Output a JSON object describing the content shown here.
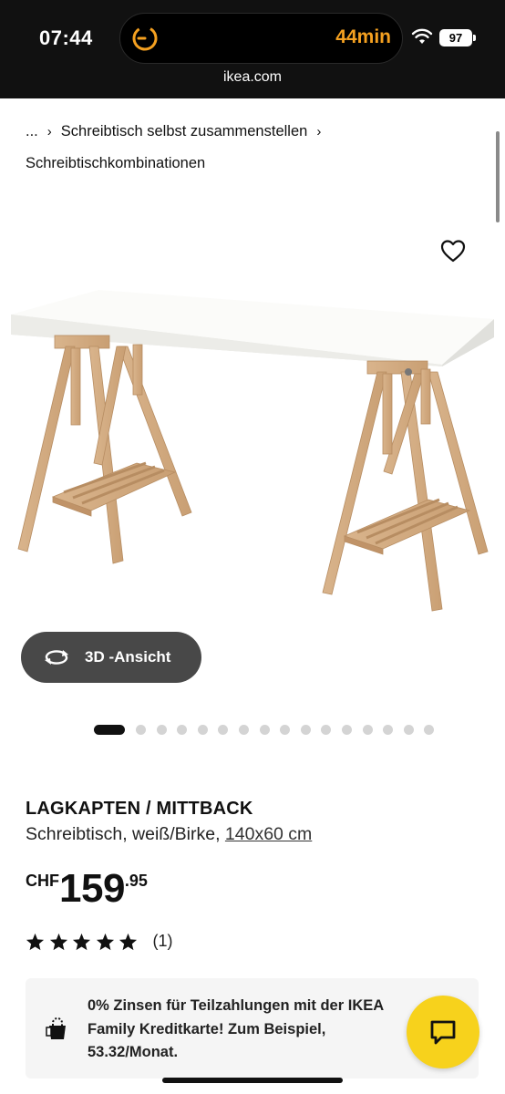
{
  "status_bar": {
    "time": "07:44",
    "timer_label": "44min",
    "battery": "97",
    "url": "ikea.com",
    "accent_color": "#f4a020"
  },
  "breadcrumb": {
    "ellipsis": "...",
    "items": [
      "Schreibtisch selbst zusammenstellen",
      "Schreibtischkombinationen"
    ]
  },
  "product": {
    "name": "LAGKAPTEN / MITTBACK",
    "description": "Schreibtisch, weiß/Birke, ",
    "size": "140x60 cm",
    "currency": "CHF",
    "price_main": "159",
    "price_decimal": ".95",
    "rating_stars": 5,
    "rating_count": "(1)"
  },
  "gallery": {
    "view_3d_label": "3D -Ansicht",
    "dot_count": 16,
    "active_index": 0
  },
  "financing": {
    "text": "0% Zinsen für Teilzahlungen mit der IKEA Family Kreditkarte! Zum Beispiel, 53.32/Monat."
  },
  "icons": {
    "favorite": "heart-icon",
    "rotate_3d": "rotate-icon",
    "chat": "chat-icon",
    "financing": "shopping-bag-icon",
    "rating": "star-icon"
  },
  "colors": {
    "chat_button": "#f7d21c",
    "view_3d_button": "#484848"
  }
}
